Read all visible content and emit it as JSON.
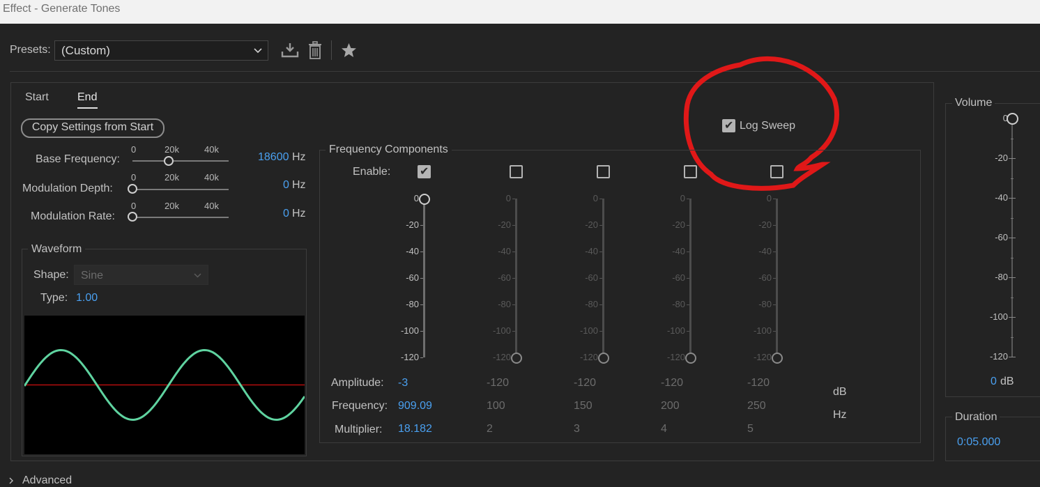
{
  "window": {
    "title": "Effect - Generate Tones"
  },
  "presets": {
    "label": "Presets:",
    "value": "(Custom)"
  },
  "tabs": {
    "start": "Start",
    "end": "End"
  },
  "copy_button": "Copy Settings from Start",
  "log_sweep": {
    "label": "Log Sweep",
    "checked": true
  },
  "sliders": {
    "ticks": [
      "0",
      "20k",
      "40k"
    ],
    "base_frequency": {
      "label": "Base Frequency:",
      "value": "18600",
      "unit": "Hz"
    },
    "modulation_depth": {
      "label": "Modulation Depth:",
      "value": "0",
      "unit": "Hz"
    },
    "modulation_rate": {
      "label": "Modulation Rate:",
      "value": "0",
      "unit": "Hz"
    }
  },
  "waveform": {
    "title": "Waveform",
    "shape_label": "Shape:",
    "shape_value": "Sine",
    "type_label": "Type:",
    "type_value": "1.00"
  },
  "freq_components": {
    "title": "Frequency Components",
    "enable_label": "Enable:",
    "amplitude_label": "Amplitude:",
    "frequency_label": "Frequency:",
    "multiplier_label": "Multiplier:",
    "db_unit": "dB",
    "hz_unit": "Hz",
    "scale": [
      "0",
      "-20",
      "-40",
      "-60",
      "-80",
      "-100",
      "-120"
    ],
    "components": [
      {
        "enabled": true,
        "amplitude": "-3",
        "frequency": "909.09",
        "multiplier": "18.182"
      },
      {
        "enabled": false,
        "amplitude": "-120",
        "frequency": "100",
        "multiplier": "2"
      },
      {
        "enabled": false,
        "amplitude": "-120",
        "frequency": "150",
        "multiplier": "3"
      },
      {
        "enabled": false,
        "amplitude": "-120",
        "frequency": "200",
        "multiplier": "4"
      },
      {
        "enabled": false,
        "amplitude": "-120",
        "frequency": "250",
        "multiplier": "5"
      }
    ]
  },
  "volume": {
    "title": "Volume",
    "value": "0",
    "unit": "dB",
    "scale": [
      "0",
      "-20",
      "-40",
      "-60",
      "-80",
      "-100",
      "-120"
    ]
  },
  "duration": {
    "title": "Duration",
    "value": "0:05.000"
  },
  "advanced": {
    "label": "Advanced"
  },
  "colors": {
    "accent_blue": "#4aa0f0",
    "wave_green": "#5fd3a0",
    "zero_line_red": "#d01010",
    "annotation_red": "#e01818"
  },
  "icons": [
    "download-icon",
    "trash-icon",
    "star-icon",
    "chevron-down-icon",
    "chevron-right-icon"
  ]
}
